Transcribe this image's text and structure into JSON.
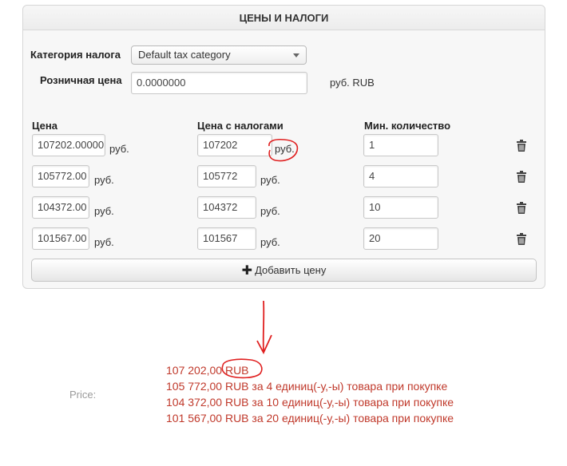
{
  "panel": {
    "title": "ЦЕНЫ И НАЛОГИ"
  },
  "tax": {
    "label": "Категория налога",
    "selected": "Default tax category"
  },
  "retail": {
    "label": "Розничная цена",
    "value": "0.0000000",
    "unit": "руб. RUB"
  },
  "columns": {
    "price": "Цена",
    "price_tax": "Цена с налогами",
    "min_qty": "Мин. количество"
  },
  "rows": [
    {
      "price": "107202.00000",
      "unit1": "руб.",
      "price_tax": "107202",
      "unit2": "руб.",
      "qty": "1"
    },
    {
      "price": "105772.00",
      "unit1": "руб.",
      "price_tax": "105772",
      "unit2": "руб.",
      "qty": "4"
    },
    {
      "price": "104372.00",
      "unit1": "руб.",
      "price_tax": "104372",
      "unit2": "руб.",
      "qty": "10"
    },
    {
      "price": "101567.00",
      "unit1": "руб.",
      "price_tax": "101567",
      "unit2": "руб.",
      "qty": "20"
    }
  ],
  "add_price": {
    "label": "Добавить цену"
  },
  "output": {
    "label": "Price:",
    "lines": [
      "107 202,00 RUB",
      "105 772,00 RUB за 4 единиц(-у,-ы) товара при покупке",
      "104 372,00 RUB за 10 единиц(-у,-ы) товара при покупке",
      "101 567,00 RUB за 20 единиц(-у,-ы) товара при покупке"
    ]
  },
  "colors": {
    "annotation": "#e02020",
    "output_text": "#c0392b"
  },
  "icons": {
    "delete": "trash-icon",
    "add": "plus-icon",
    "dropdown": "caret-down-icon"
  }
}
